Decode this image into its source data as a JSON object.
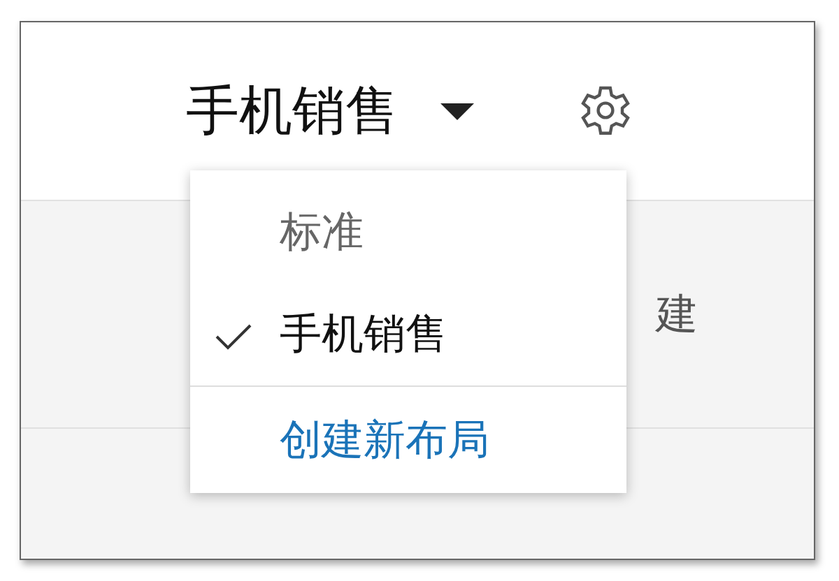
{
  "header": {
    "title": "手机销售"
  },
  "background_row": {
    "text": "建"
  },
  "dropdown": {
    "items": [
      {
        "label": "标准",
        "selected": false
      },
      {
        "label": "手机销售",
        "selected": true
      }
    ],
    "action": "创建新布局"
  }
}
